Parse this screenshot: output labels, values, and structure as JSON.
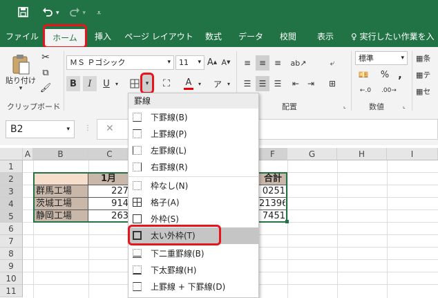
{
  "qat": {
    "save_icon": "save-icon",
    "undo_icon": "undo-icon",
    "redo_icon": "redo-icon",
    "customize_icon": "customize-icon"
  },
  "tabs": [
    "ファイル",
    "ホーム",
    "挿入",
    "ページ レイアウト",
    "数式",
    "データ",
    "校閲",
    "表示"
  ],
  "tell_me": "実行したい作業を入",
  "clipboard": {
    "paste_label": "貼り付け",
    "paste_arrow": "▾",
    "group_label": "クリップボード"
  },
  "font": {
    "name": "ＭＳ Ｐゴシック",
    "size": "11",
    "bold": "B",
    "italic": "I",
    "underline": "U",
    "increase": "A",
    "decrease": "A",
    "font_color_label": "A"
  },
  "alignment": {
    "group_label": "配置"
  },
  "number": {
    "format": "標準",
    "percent": "%",
    "comma": ",",
    "group_label": "数値"
  },
  "styles": {
    "cond": "条",
    "table": "テ",
    "cell": "セ"
  },
  "formula": {
    "namebox": "B2",
    "cancel": "✕"
  },
  "grid": {
    "columns": [
      "A",
      "B",
      "C",
      "D",
      "E",
      "F",
      "G",
      "H",
      "I"
    ],
    "rows": [
      "1",
      "2",
      "3",
      "4",
      "5",
      "6",
      "7",
      "8",
      "9",
      "10",
      "11"
    ],
    "c2": "1月",
    "f2": "合計",
    "b3": "群馬工場",
    "c3": "227",
    "f3": "0251",
    "b4": "茨城工場",
    "c4": "914",
    "f4": "21396",
    "b5": "静岡工場",
    "c5": "263",
    "f5": "7451"
  },
  "dropdown": {
    "header": "罫線",
    "items": [
      "下罫線(B)",
      "上罫線(P)",
      "左罫線(L)",
      "右罫線(R)",
      "枠なし(N)",
      "格子(A)",
      "外枠(S)",
      "太い外枠(T)",
      "下二重罫線(B)",
      "下太罫線(H)",
      "上罫線 + 下罫線(D)"
    ]
  },
  "colors": {
    "brand": "#217346",
    "highlight": "#e8141b",
    "header_fill": "#c9b7a9"
  }
}
